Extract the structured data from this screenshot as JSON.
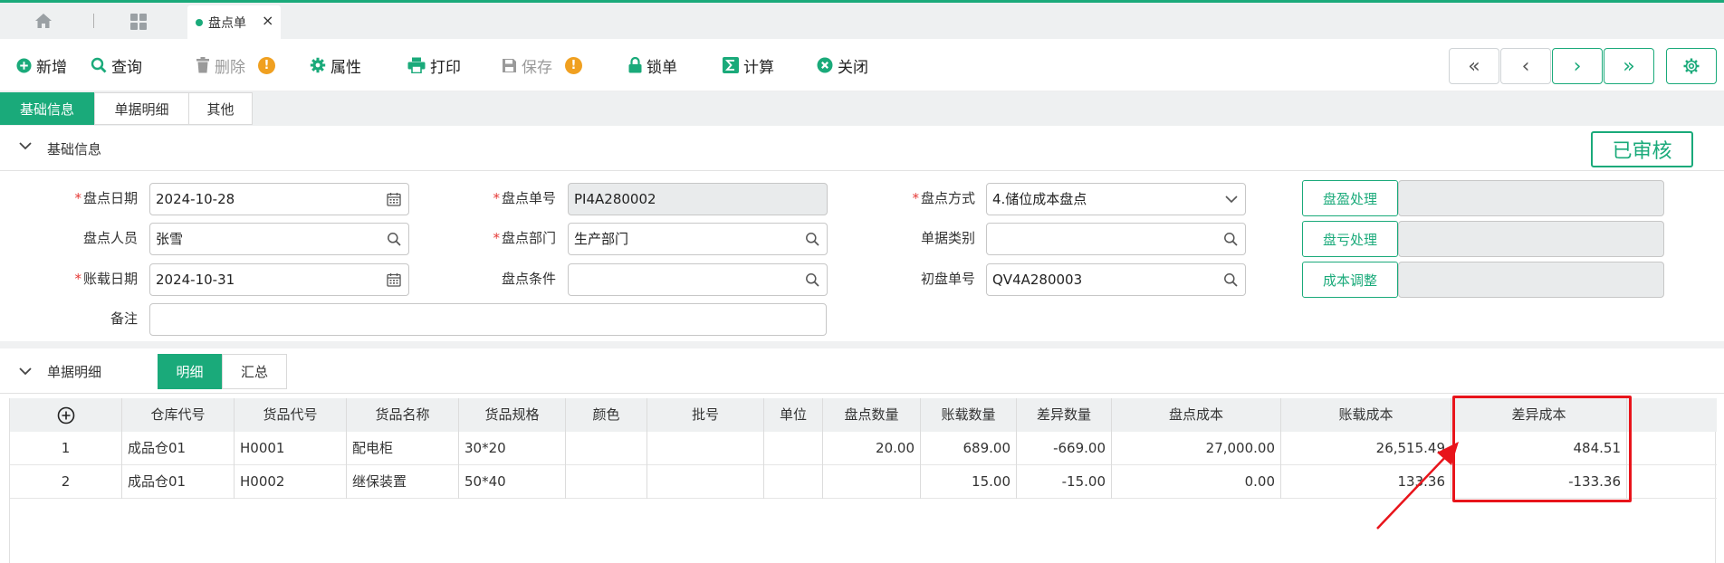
{
  "tabbar": {
    "open_tab_label": "盘点单",
    "close_glyph": "×"
  },
  "toolbar": {
    "add": "新增",
    "query": "查询",
    "delete": "删除",
    "properties": "属性",
    "print": "打印",
    "save": "保存",
    "lock": "锁单",
    "calculate": "计算",
    "close": "关闭",
    "warn_glyph": "!"
  },
  "nav": {
    "first": "«",
    "prev": "‹",
    "next": "›",
    "last": "»"
  },
  "section_tabs": [
    "基础信息",
    "单据明细",
    "其他"
  ],
  "basic": {
    "title": "基础信息",
    "status": "已审核",
    "fields": {
      "count_date_label": "盘点日期",
      "count_date": "2024-10-28",
      "counter_label": "盘点人员",
      "counter": "张雪",
      "account_date_label": "账载日期",
      "account_date": "2024-10-31",
      "remark_label": "备注",
      "remark": "",
      "count_no_label": "盘点单号",
      "count_no": "PI4A280002",
      "dept_label": "盘点部门",
      "dept": "生产部门",
      "condition_label": "盘点条件",
      "condition": "",
      "method_label": "盘点方式",
      "method": "4.储位成本盘点",
      "doc_type_label": "单据类别",
      "doc_type": "",
      "initial_no_label": "初盘单号",
      "initial_no": "QV4A280003"
    },
    "actions": [
      "盘盈处理",
      "盘亏处理",
      "成本调整"
    ]
  },
  "detail": {
    "title": "单据明细",
    "tabs": [
      "明细",
      "汇总"
    ],
    "columns": [
      "仓库代号",
      "货品代号",
      "货品名称",
      "货品规格",
      "颜色",
      "批号",
      "单位",
      "盘点数量",
      "账载数量",
      "差异数量",
      "盘点成本",
      "账载成本",
      "差异成本"
    ],
    "rows": [
      {
        "no": "1",
        "warehouse": "成品仓01",
        "code": "H0001",
        "name": "配电柜",
        "spec": "30*20",
        "color": "",
        "batch": "",
        "unit": "",
        "count_qty": "20.00",
        "book_qty": "689.00",
        "diff_qty": "-669.00",
        "count_cost": "27,000.00",
        "book_cost": "26,515.49",
        "diff_cost": "484.51"
      },
      {
        "no": "2",
        "warehouse": "成品仓01",
        "code": "H0002",
        "name": "继保装置",
        "spec": "50*40",
        "color": "",
        "batch": "",
        "unit": "",
        "count_qty": "",
        "book_qty": "15.00",
        "diff_qty": "-15.00",
        "count_cost": "0.00",
        "book_cost": "133.36",
        "diff_cost": "-133.36"
      }
    ]
  },
  "colors": {
    "accent": "#1aaa7a",
    "annotation": "#e8141b",
    "warning": "#f0a020"
  }
}
